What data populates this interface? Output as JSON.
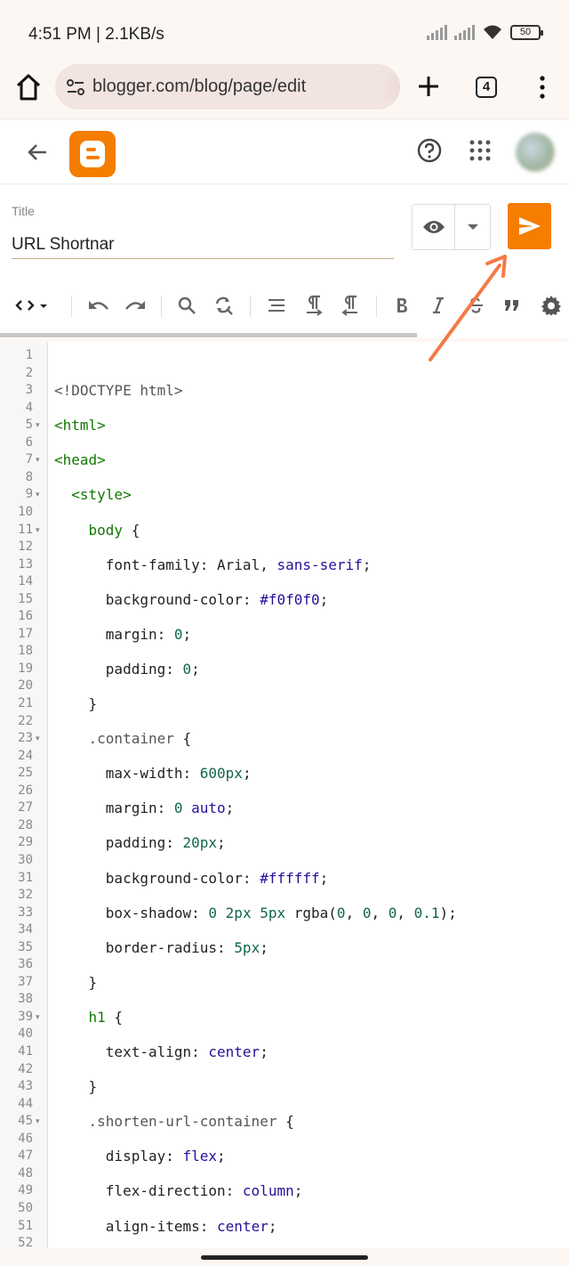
{
  "status_bar": {
    "time": "4:51 PM | 2.1KB/s",
    "battery": "50"
  },
  "browser": {
    "url": "blogger.com/blog/page/edit",
    "tab_count": "4"
  },
  "title_section": {
    "label": "Title",
    "value": "URL Shortnar"
  },
  "colors": {
    "brand": "#f57d00",
    "annotation_arrow": "#f47a44"
  },
  "icons": [
    "home-icon",
    "site-info-icon",
    "plus-icon",
    "tabs-icon",
    "more-vert-icon",
    "back-arrow-icon",
    "blogger-logo-icon",
    "help-icon",
    "apps-icon",
    "avatar",
    "eye-icon",
    "dropdown-icon",
    "send-icon",
    "code-view-icon",
    "undo-icon",
    "redo-icon",
    "search-icon",
    "find-replace-icon",
    "format-align-icon",
    "ltr-icon",
    "rtl-icon",
    "bold-icon",
    "italic-icon",
    "strikethrough-icon",
    "quote-icon",
    "settings-icon"
  ],
  "editor": {
    "line_numbers": [
      "1",
      "2",
      "3",
      "4",
      "5",
      "6",
      "7",
      "8",
      "9",
      "10",
      "11",
      "12",
      "13",
      "14",
      "15",
      "16",
      "17",
      "18",
      "19",
      "20",
      "21",
      "22",
      "23",
      "24",
      "25",
      "26",
      "27",
      "28",
      "29",
      "30",
      "31",
      "32",
      "33",
      "34",
      "35",
      "36",
      "37",
      "38",
      "39",
      "40",
      "41",
      "42",
      "43",
      "44",
      "45",
      "46",
      "47",
      "48",
      "49",
      "50",
      "51",
      "52"
    ],
    "lines": [
      "<!DOCTYPE html>",
      "<html>",
      "<head>",
      "  <style>",
      "    body {",
      "      font-family: Arial, sans-serif;",
      "      background-color: #f0f0f0;",
      "      margin: 0;",
      "      padding: 0;",
      "    }",
      "    .container {",
      "      max-width: 600px;",
      "      margin: 0 auto;",
      "      padding: 20px;",
      "      background-color: #ffffff;",
      "      box-shadow: 0 2px 5px rgba(0, 0, 0, 0.1);",
      "      border-radius: 5px;",
      "    }",
      "    h1 {",
      "      text-align: center;",
      "    }",
      "    .shorten-url-container {",
      "      display: flex;",
      "      flex-direction: column;",
      "      align-items: center;"
    ]
  }
}
